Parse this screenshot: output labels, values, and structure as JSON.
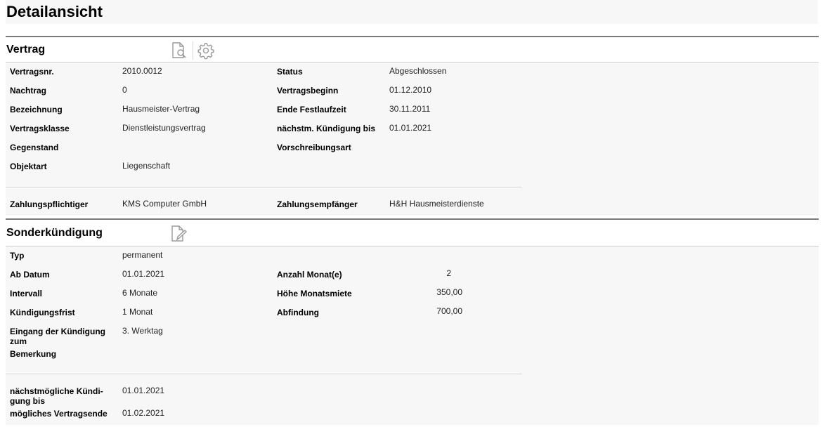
{
  "page": {
    "title": "Detailansicht"
  },
  "vertrag": {
    "title": "Vertrag",
    "icons": [
      "document-search-icon",
      "gear-icon"
    ],
    "left": [
      {
        "label": "Vertragsnr.",
        "value": "2010.0012"
      },
      {
        "label": "Nachtrag",
        "value": "0"
      },
      {
        "label": "Bezeichnung",
        "value": "Hausmeister-Vertrag"
      },
      {
        "label": "Vertragsklasse",
        "value": "Dienstleistungsvertrag"
      },
      {
        "label": "Gegenstand",
        "value": ""
      },
      {
        "label": "Objektart",
        "value": "Liegenschaft"
      }
    ],
    "right": [
      {
        "label": "Status",
        "value": "Abgeschlossen"
      },
      {
        "label": "Vertragsbeginn",
        "value": "01.12.2010"
      },
      {
        "label": "Ende Festlaufzeit",
        "value": "30.11.2011"
      },
      {
        "label": "nächstm. Kündigung bis",
        "value": "01.01.2021"
      },
      {
        "label": "Vorschreibungsart",
        "value": ""
      }
    ],
    "parties": {
      "payer_label": "Zahlungspflichtiger",
      "payer_value": "KMS Computer GmbH",
      "payee_label": "Zahlungsempfänger",
      "payee_value": "H&H Hausmeisterdienste"
    }
  },
  "sonder": {
    "title": "Sonderkündigung",
    "icons": [
      "document-edit-icon"
    ],
    "left": [
      {
        "label": "Typ",
        "value": "permanent"
      },
      {
        "label": "Ab Datum",
        "value": "01.01.2021"
      },
      {
        "label": "Intervall",
        "value": "6 Monate"
      },
      {
        "label": "Kündigungsfrist",
        "value": "1 Monat"
      },
      {
        "label": "Eingang der Kündigung zum",
        "value": "3. Werktag"
      },
      {
        "label": "Bemerkung",
        "value": ""
      }
    ],
    "right": [
      {
        "label": "Anzahl Monat(e)",
        "value": "2"
      },
      {
        "label": "Höhe Monatsmiete",
        "value": "350,00"
      },
      {
        "label": "Abfindung",
        "value": "700,00"
      }
    ],
    "footer": [
      {
        "label": "nächstmögliche Kündi-gung bis",
        "value": "01.01.2021"
      },
      {
        "label": "mögliches Vertragsende",
        "value": "01.02.2021"
      }
    ]
  }
}
